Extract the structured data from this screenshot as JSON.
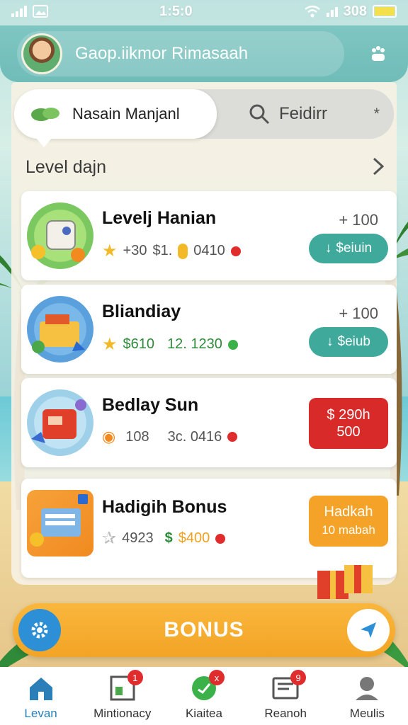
{
  "status_bar": {
    "time": "1:5:0",
    "battery_text": "308"
  },
  "header": {
    "title": "Gaop.iikmor Rimasaah"
  },
  "segment": {
    "active_label": "Nasain Manjanl",
    "search_label": "Feidirr",
    "close_glyph": "*"
  },
  "section": {
    "title": "Level dajn"
  },
  "cards": [
    {
      "title": "Levelj Hanian",
      "value": "+ 100",
      "meta": [
        "+30",
        "$1.",
        "0410"
      ],
      "button": "$eiuin",
      "colors": {
        "button": "#3fa99c"
      }
    },
    {
      "title": "Bliandiay",
      "value": "+ 100",
      "meta": [
        "$610",
        "12. 1230"
      ],
      "button": "$eiub",
      "colors": {
        "button": "#3fa99c"
      }
    },
    {
      "title": "Bedlay Sun",
      "meta": [
        "108",
        "3c. 0416"
      ],
      "button_line1": "$ 290h",
      "button_line2": "500",
      "colors": {
        "button": "#d92a2a"
      }
    },
    {
      "title": "Hadigih Bonus",
      "meta": [
        "4923",
        "$400"
      ],
      "button_line1": "Hadkah",
      "button_line2": "10 mabah",
      "colors": {
        "button": "#f4a228"
      }
    }
  ],
  "bonus_bar": {
    "label": "BONUS"
  },
  "bottom_nav": [
    {
      "label": "Levan",
      "icon": "home-icon",
      "active": true
    },
    {
      "label": "Mintionacy",
      "icon": "board-icon",
      "badge": "1"
    },
    {
      "label": "Kiaitea",
      "icon": "chat-icon",
      "badge": "x"
    },
    {
      "label": "Reanoh",
      "icon": "news-icon",
      "badge": "9"
    },
    {
      "label": "Meulis",
      "icon": "profile-icon"
    }
  ]
}
